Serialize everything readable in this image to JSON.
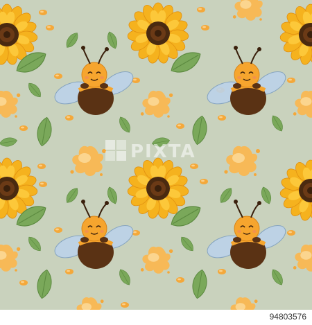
{
  "watermark": {
    "text": "PIXTA"
  },
  "credit": {
    "id": "94803576"
  },
  "palette": {
    "background": "#c9d2bd",
    "honey": "#f4a83a",
    "honey_light": "#fbd089",
    "petal": "#f5b21e",
    "sunflower_center": "#4a2a10",
    "leaf": "#7aa85a",
    "bee_body": "#f6a52e",
    "bee_stripe": "#5a3214",
    "wing": "#bcd3ea"
  },
  "pattern": {
    "motifs": [
      "sunflower",
      "bee",
      "honey-splash",
      "leaf",
      "honey-drop"
    ]
  }
}
